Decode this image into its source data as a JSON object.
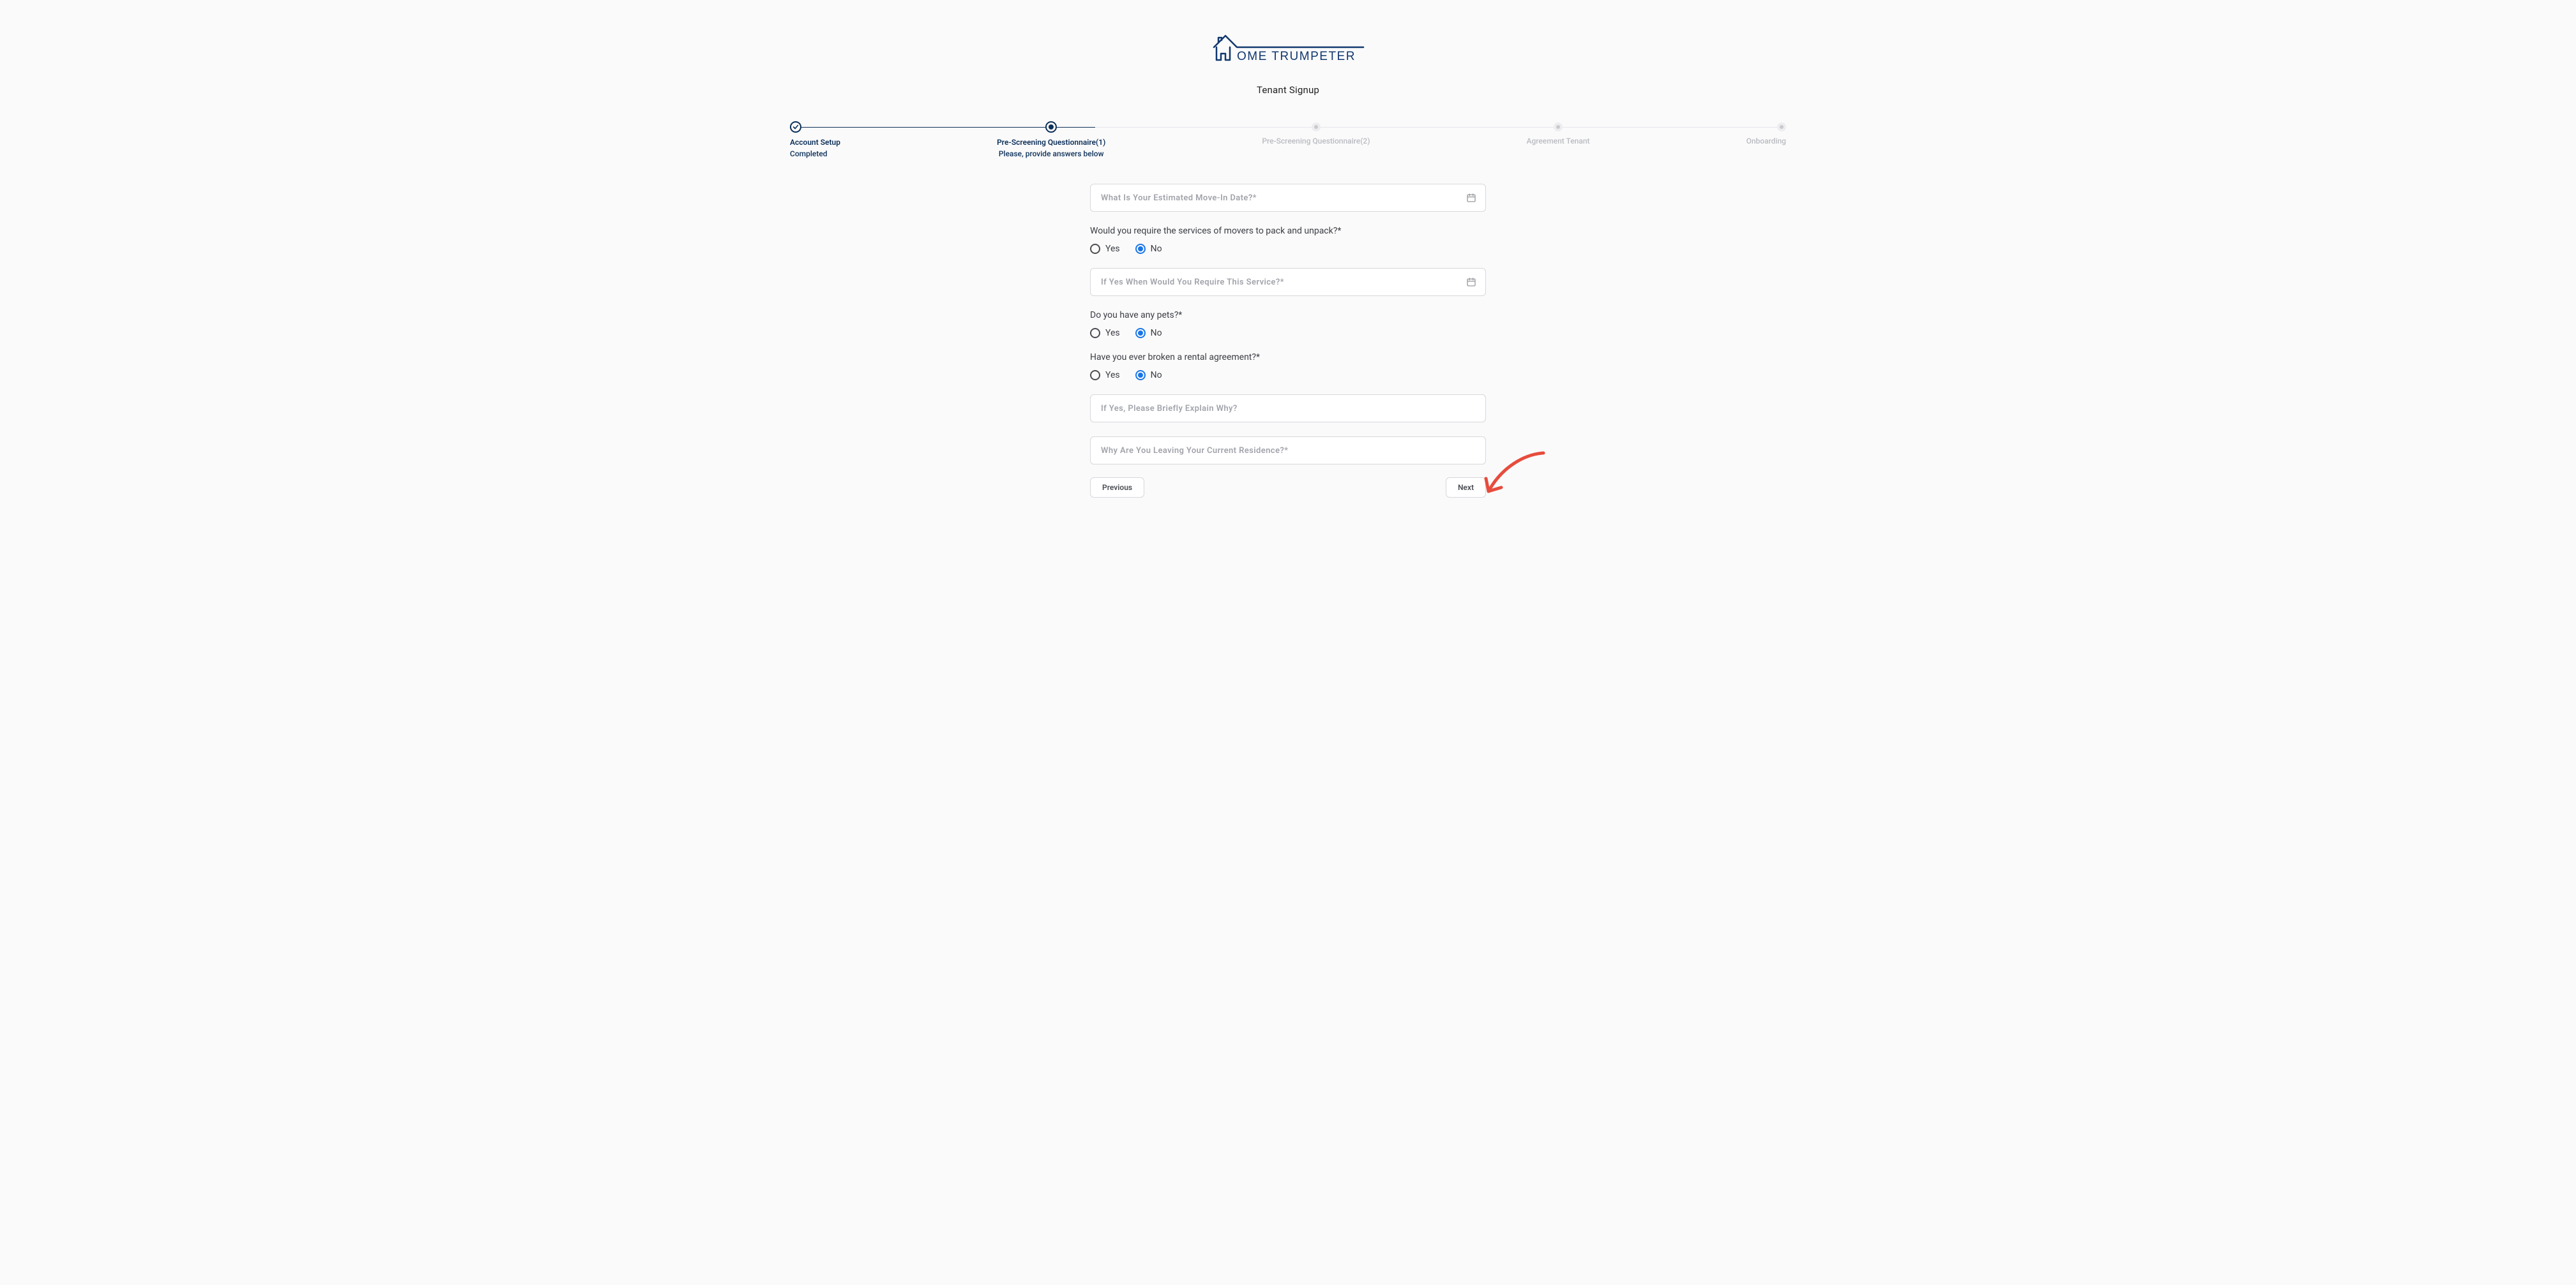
{
  "brand": {
    "name_prefix": "OME",
    "name_word": "TRUMPETER"
  },
  "subtitle": "Tenant Signup",
  "stepper": {
    "steps": [
      {
        "label": "Account Setup",
        "sub": "Completed",
        "state": "completed",
        "align": "left"
      },
      {
        "label": "Pre-Screening Questionnaire(1)",
        "sub": "Please, provide answers below",
        "state": "active",
        "align": "center"
      },
      {
        "label": "Pre-Screening Questionnaire(2)",
        "sub": "",
        "state": "pending",
        "align": "center"
      },
      {
        "label": "Agreement Tenant",
        "sub": "",
        "state": "pending",
        "align": "center"
      },
      {
        "label": "Onboarding",
        "sub": "",
        "state": "pending",
        "align": "right"
      }
    ],
    "active_fraction_pct": "30%"
  },
  "form": {
    "move_in_date": {
      "placeholder": "What Is Your Estimated Move-In Date?*",
      "value": ""
    },
    "movers_question": "Would you require the services of movers to pack and unpack?*",
    "movers_yes": "Yes",
    "movers_no": "No",
    "movers_value": "no",
    "movers_service_date": {
      "placeholder": "If Yes When Would You Require This Service?*",
      "value": ""
    },
    "pets_question": "Do you have any pets?*",
    "pets_yes": "Yes",
    "pets_no": "No",
    "pets_value": "no",
    "broken_question": "Have you ever broken a rental agreement?*",
    "broken_yes": "Yes",
    "broken_no": "No",
    "broken_value": "no",
    "broken_explain": {
      "placeholder": "If Yes, Please Briefly Explain Why?",
      "value": ""
    },
    "leaving_reason": {
      "placeholder": "Why Are You Leaving Your Current Residence?*",
      "value": ""
    },
    "btn_prev": "Previous",
    "btn_next": "Next"
  },
  "colors": {
    "brand": "#11386e",
    "step_active": "#0d3058",
    "radio_checked": "#1976e8",
    "annotation": "#e74c3c"
  }
}
